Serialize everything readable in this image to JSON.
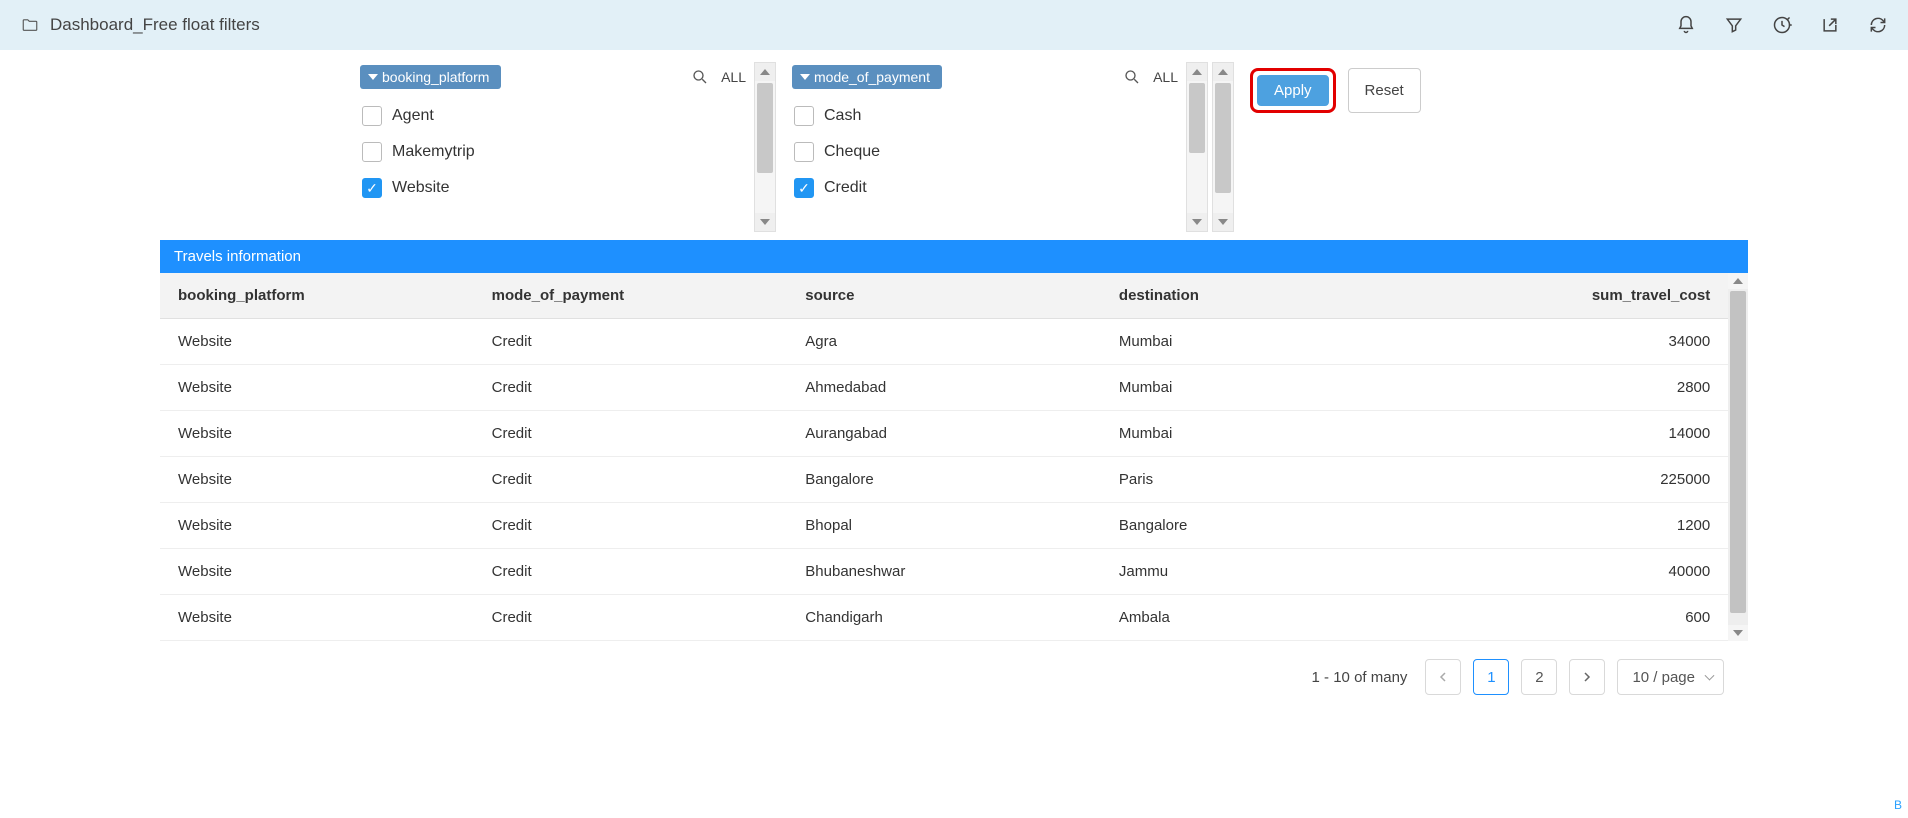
{
  "header": {
    "title": "Dashboard_Free float filters"
  },
  "filters": [
    {
      "name": "booking_platform",
      "all_label": "ALL",
      "items": [
        {
          "label": "Agent",
          "checked": false
        },
        {
          "label": "Makemytrip",
          "checked": false
        },
        {
          "label": "Website",
          "checked": true
        }
      ]
    },
    {
      "name": "mode_of_payment",
      "all_label": "ALL",
      "items": [
        {
          "label": "Cash",
          "checked": false
        },
        {
          "label": "Cheque",
          "checked": false
        },
        {
          "label": "Credit",
          "checked": true
        }
      ]
    }
  ],
  "actions": {
    "apply": "Apply",
    "reset": "Reset"
  },
  "panel": {
    "title": "Travels information",
    "columns": [
      "booking_platform",
      "mode_of_payment",
      "source",
      "destination",
      "sum_travel_cost"
    ],
    "rows": [
      {
        "booking_platform": "Website",
        "mode_of_payment": "Credit",
        "source": "Agra",
        "destination": "Mumbai",
        "sum_travel_cost": "34000"
      },
      {
        "booking_platform": "Website",
        "mode_of_payment": "Credit",
        "source": "Ahmedabad",
        "destination": "Mumbai",
        "sum_travel_cost": "2800"
      },
      {
        "booking_platform": "Website",
        "mode_of_payment": "Credit",
        "source": "Aurangabad",
        "destination": "Mumbai",
        "sum_travel_cost": "14000"
      },
      {
        "booking_platform": "Website",
        "mode_of_payment": "Credit",
        "source": "Bangalore",
        "destination": "Paris",
        "sum_travel_cost": "225000"
      },
      {
        "booking_platform": "Website",
        "mode_of_payment": "Credit",
        "source": "Bhopal",
        "destination": "Bangalore",
        "sum_travel_cost": "1200"
      },
      {
        "booking_platform": "Website",
        "mode_of_payment": "Credit",
        "source": "Bhubaneshwar",
        "destination": "Jammu",
        "sum_travel_cost": "40000"
      },
      {
        "booking_platform": "Website",
        "mode_of_payment": "Credit",
        "source": "Chandigarh",
        "destination": "Ambala",
        "sum_travel_cost": "600"
      }
    ]
  },
  "pagination": {
    "info": "1 - 10 of many",
    "pages": [
      "1",
      "2"
    ],
    "active": "1",
    "size_label": "10 / page"
  },
  "corner_badge": "B"
}
